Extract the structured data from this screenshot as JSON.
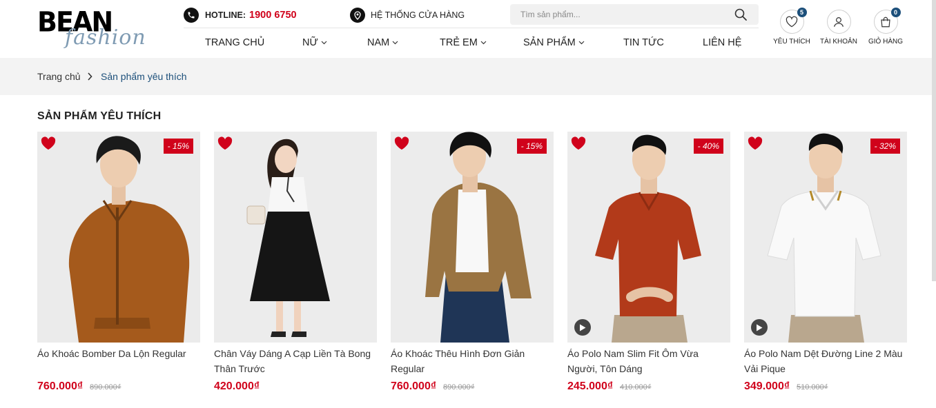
{
  "brand": {
    "line1": "BEAN",
    "line2": "fashion"
  },
  "topbar": {
    "hotline_label": "HOTLINE:",
    "hotline_number": "1900 6750",
    "stores_label": "HỆ THỐNG CỬA HÀNG",
    "search_placeholder": "Tìm sản phẩm..."
  },
  "nav": {
    "items": [
      {
        "label": "TRANG CHỦ"
      },
      {
        "label": "NỮ"
      },
      {
        "label": "NAM"
      },
      {
        "label": "TRẺ EM"
      },
      {
        "label": "SẢN PHẨM"
      },
      {
        "label": "TIN TỨC"
      },
      {
        "label": "LIÊN HỆ"
      }
    ]
  },
  "header_icons": {
    "wishlist": {
      "label": "YÊU THÍCH",
      "count": "5",
      "icon": "heart-icon"
    },
    "account": {
      "label": "TÀI KHOẢN",
      "icon": "user-icon"
    },
    "cart": {
      "label": "GIỎ HÀNG",
      "count": "0",
      "icon": "bag-icon"
    }
  },
  "breadcrumb": {
    "home": "Trang chủ",
    "current": "Sản phẩm yêu thích"
  },
  "section_title": "SẢN PHẨM YÊU THÍCH",
  "colors": {
    "accent": "#d0021b",
    "brand_blue": "#1c4f7a"
  },
  "products": [
    {
      "name": "Áo Khoác Bomber Da Lộn Regular",
      "price": "760.000₫",
      "old_price": "890.000₫",
      "discount": "- 15%"
    },
    {
      "name": "Chân Váy Dáng A Cạp Liền Tà Bong Thân Trước",
      "price": "420.000₫",
      "old_price": "",
      "discount": ""
    },
    {
      "name": "Áo Khoác Thêu Hình Đơn Giản Regular",
      "price": "760.000₫",
      "old_price": "890.000₫",
      "discount": "- 15%"
    },
    {
      "name": "Áo Polo Nam Slim Fit Ôm Vừa Người, Tôn Dáng",
      "price": "245.000₫",
      "old_price": "410.000₫",
      "discount": "- 40%"
    },
    {
      "name": "Áo Polo Nam Dệt Đường Line 2 Màu Vải Pique",
      "price": "349.000₫",
      "old_price": "510.000₫",
      "discount": "- 32%"
    }
  ]
}
